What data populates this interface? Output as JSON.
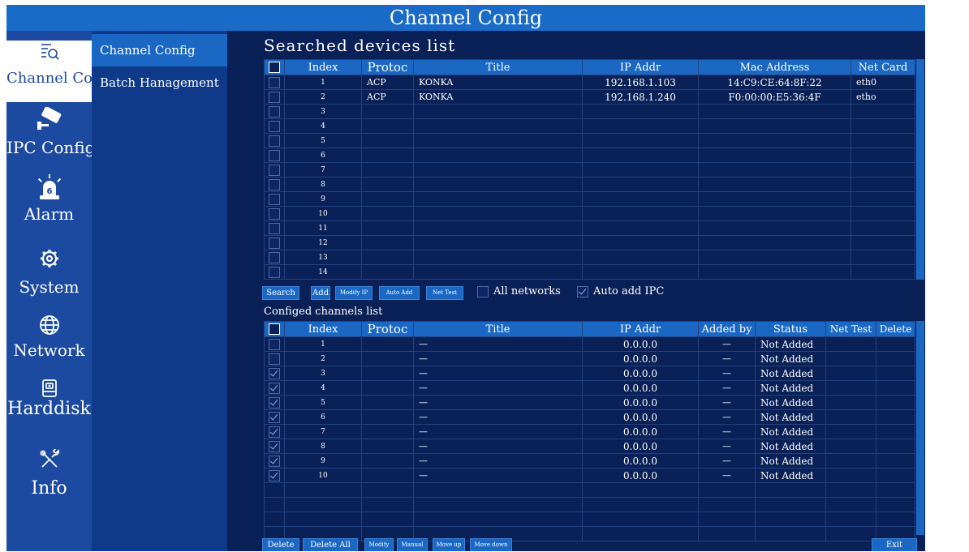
{
  "window": {
    "title": "Channel Config"
  },
  "nav": [
    {
      "label": "Channel Co",
      "icon": "search-list-icon"
    },
    {
      "label": "IPC Config",
      "icon": "camera-icon"
    },
    {
      "label": "Alarm",
      "icon": "alarm-icon"
    },
    {
      "label": "System",
      "icon": "gear-icon"
    },
    {
      "label": "Network",
      "icon": "globe-icon"
    },
    {
      "label": "Harddisk",
      "icon": "disk-icon"
    },
    {
      "label": "Info",
      "icon": "tools-icon"
    }
  ],
  "submenu": [
    "Channel Config",
    "Batch Hanagement"
  ],
  "searched": {
    "title": "Searched devices list",
    "headers": [
      "Index",
      "Protoc",
      "Title",
      "IP Addr",
      "Mac Address",
      "Net Card"
    ],
    "rows": [
      {
        "index": "1",
        "protocol": "ACP",
        "title": "KONKA",
        "ip": "192.168.1.103",
        "mac": "14:C9:CE:64:8F:22",
        "netcard": "eth0"
      },
      {
        "index": "2",
        "protocol": "ACP",
        "title": "KONKA",
        "ip": "192.168.1.240",
        "mac": "F0:00:00:E5:36:4F",
        "netcard": "etho"
      },
      {
        "index": "3",
        "protocol": "",
        "title": "",
        "ip": "",
        "mac": "",
        "netcard": ""
      },
      {
        "index": "4",
        "protocol": "",
        "title": "",
        "ip": "",
        "mac": "",
        "netcard": ""
      },
      {
        "index": "5",
        "protocol": "",
        "title": "",
        "ip": "",
        "mac": "",
        "netcard": ""
      },
      {
        "index": "6",
        "protocol": "",
        "title": "",
        "ip": "",
        "mac": "",
        "netcard": ""
      },
      {
        "index": "7",
        "protocol": "",
        "title": "",
        "ip": "",
        "mac": "",
        "netcard": ""
      },
      {
        "index": "8",
        "protocol": "",
        "title": "",
        "ip": "",
        "mac": "",
        "netcard": ""
      },
      {
        "index": "9",
        "protocol": "",
        "title": "",
        "ip": "",
        "mac": "",
        "netcard": ""
      },
      {
        "index": "10",
        "protocol": "",
        "title": "",
        "ip": "",
        "mac": "",
        "netcard": ""
      },
      {
        "index": "11",
        "protocol": "",
        "title": "",
        "ip": "",
        "mac": "",
        "netcard": ""
      },
      {
        "index": "12",
        "protocol": "",
        "title": "",
        "ip": "",
        "mac": "",
        "netcard": ""
      },
      {
        "index": "13",
        "protocol": "",
        "title": "",
        "ip": "",
        "mac": "",
        "netcard": ""
      },
      {
        "index": "14",
        "protocol": "",
        "title": "",
        "ip": "",
        "mac": "",
        "netcard": ""
      }
    ]
  },
  "search_toolbar": {
    "buttons": [
      "Search",
      "Add",
      "Modify IP",
      "Auto Add",
      "Net Test"
    ],
    "all_networks": {
      "label": "All networks",
      "checked": false
    },
    "auto_add_ipc": {
      "label": "Auto add IPC",
      "checked": true
    }
  },
  "configured": {
    "title": "Configed channels list",
    "headers": [
      "Index",
      "Protoc",
      "Title",
      "IP Addr",
      "Added by",
      "Status",
      "Net Test",
      "Delete"
    ],
    "rows": [
      {
        "checked": false,
        "index": "1",
        "protocol": "",
        "title": "—",
        "ip": "0.0.0.0",
        "added_by": "—",
        "status": "Not Added"
      },
      {
        "checked": false,
        "index": "2",
        "protocol": "",
        "title": "—",
        "ip": "0.0.0.0",
        "added_by": "—",
        "status": "Not Added"
      },
      {
        "checked": true,
        "index": "3",
        "protocol": "",
        "title": "—",
        "ip": "0.0.0.0",
        "added_by": "—",
        "status": "Not Added"
      },
      {
        "checked": true,
        "index": "4",
        "protocol": "",
        "title": "—",
        "ip": "0.0.0.0",
        "added_by": "—",
        "status": "Not Added"
      },
      {
        "checked": true,
        "index": "5",
        "protocol": "",
        "title": "—",
        "ip": "0.0.0.0",
        "added_by": "—",
        "status": "Not Added"
      },
      {
        "checked": true,
        "index": "6",
        "protocol": "",
        "title": "—",
        "ip": "0.0.0.0",
        "added_by": "—",
        "status": "Not Added"
      },
      {
        "checked": true,
        "index": "7",
        "protocol": "",
        "title": "—",
        "ip": "0.0.0.0",
        "added_by": "—",
        "status": "Not Added"
      },
      {
        "checked": true,
        "index": "8",
        "protocol": "",
        "title": "—",
        "ip": "0.0.0.0",
        "added_by": "—",
        "status": "Not Added"
      },
      {
        "checked": true,
        "index": "9",
        "protocol": "",
        "title": "—",
        "ip": "0.0.0.0",
        "added_by": "—",
        "status": "Not Added"
      },
      {
        "checked": true,
        "index": "10",
        "protocol": "",
        "title": "—",
        "ip": "0.0.0.0",
        "added_by": "—",
        "status": "Not Added"
      }
    ]
  },
  "bottom_toolbar": {
    "buttons": [
      "Delete",
      "Delete All",
      "Modify",
      "Manual",
      "Move up",
      "Move down"
    ],
    "exit": "Exit"
  },
  "colors": {
    "title_bar": "#1a6bc8",
    "icon_bar": "#1c4aa0",
    "submenu": "#0f3a8a",
    "content_bg": "#0a2158",
    "header_row": "#1a68c4"
  }
}
